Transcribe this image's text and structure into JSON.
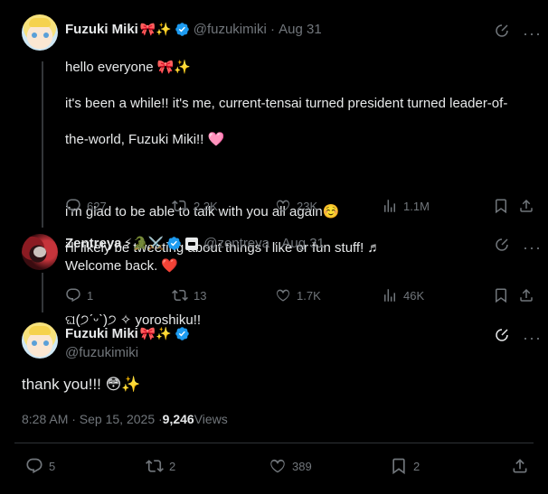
{
  "tweet1": {
    "name": "Fuzuki Miki",
    "name_emojis": "🎀✨",
    "handle": "@fuzukimiki",
    "date": "Aug 31",
    "line1": "hello everyone 🎀✨",
    "line2": "it's been a while!! it's me, current-tensai turned president turned leader-of-",
    "line3": "the-world, Fuzuki Miki!! 🩷",
    "line4": "i'm glad to be able to talk with you all again☺️",
    "line5": "i'll likely be tweeting about things i like or fun stuff! ♬",
    "line6": "ଘ(੭ˊᵕˋ)੭ ✧ yoroshiku!!",
    "replies": "627",
    "reposts": "2.3K",
    "likes": "23K",
    "views": "1.1M"
  },
  "tweet2": {
    "name": "Zentreya",
    "name_emojis": "⚡🐊⚔️",
    "handle": "@zentreya",
    "date": "Aug 31",
    "text": "Welcome back. ❤️",
    "replies": "1",
    "reposts": "13",
    "likes": "1.7K",
    "views": "46K"
  },
  "main": {
    "name": "Fuzuki Miki",
    "name_emojis": "🎀✨",
    "handle": "@fuzukimiki",
    "text": "thank you!!! 😳✨",
    "time": "8:28 AM · Sep 15, 2025 · ",
    "views_count": "9,246",
    "views_label": " Views",
    "replies": "5",
    "reposts": "2",
    "likes": "389",
    "bookmarks": "2"
  },
  "colors": {
    "background": "#000000",
    "text": "#e7e9ea",
    "muted": "#71767b",
    "verified": "#1d9bf0",
    "divider": "#2f3336"
  },
  "icons": [
    "grok-icon",
    "more-icon",
    "reply-icon",
    "repost-icon",
    "like-icon",
    "views-icon",
    "bookmark-icon",
    "share-icon",
    "verified-badge-icon"
  ]
}
